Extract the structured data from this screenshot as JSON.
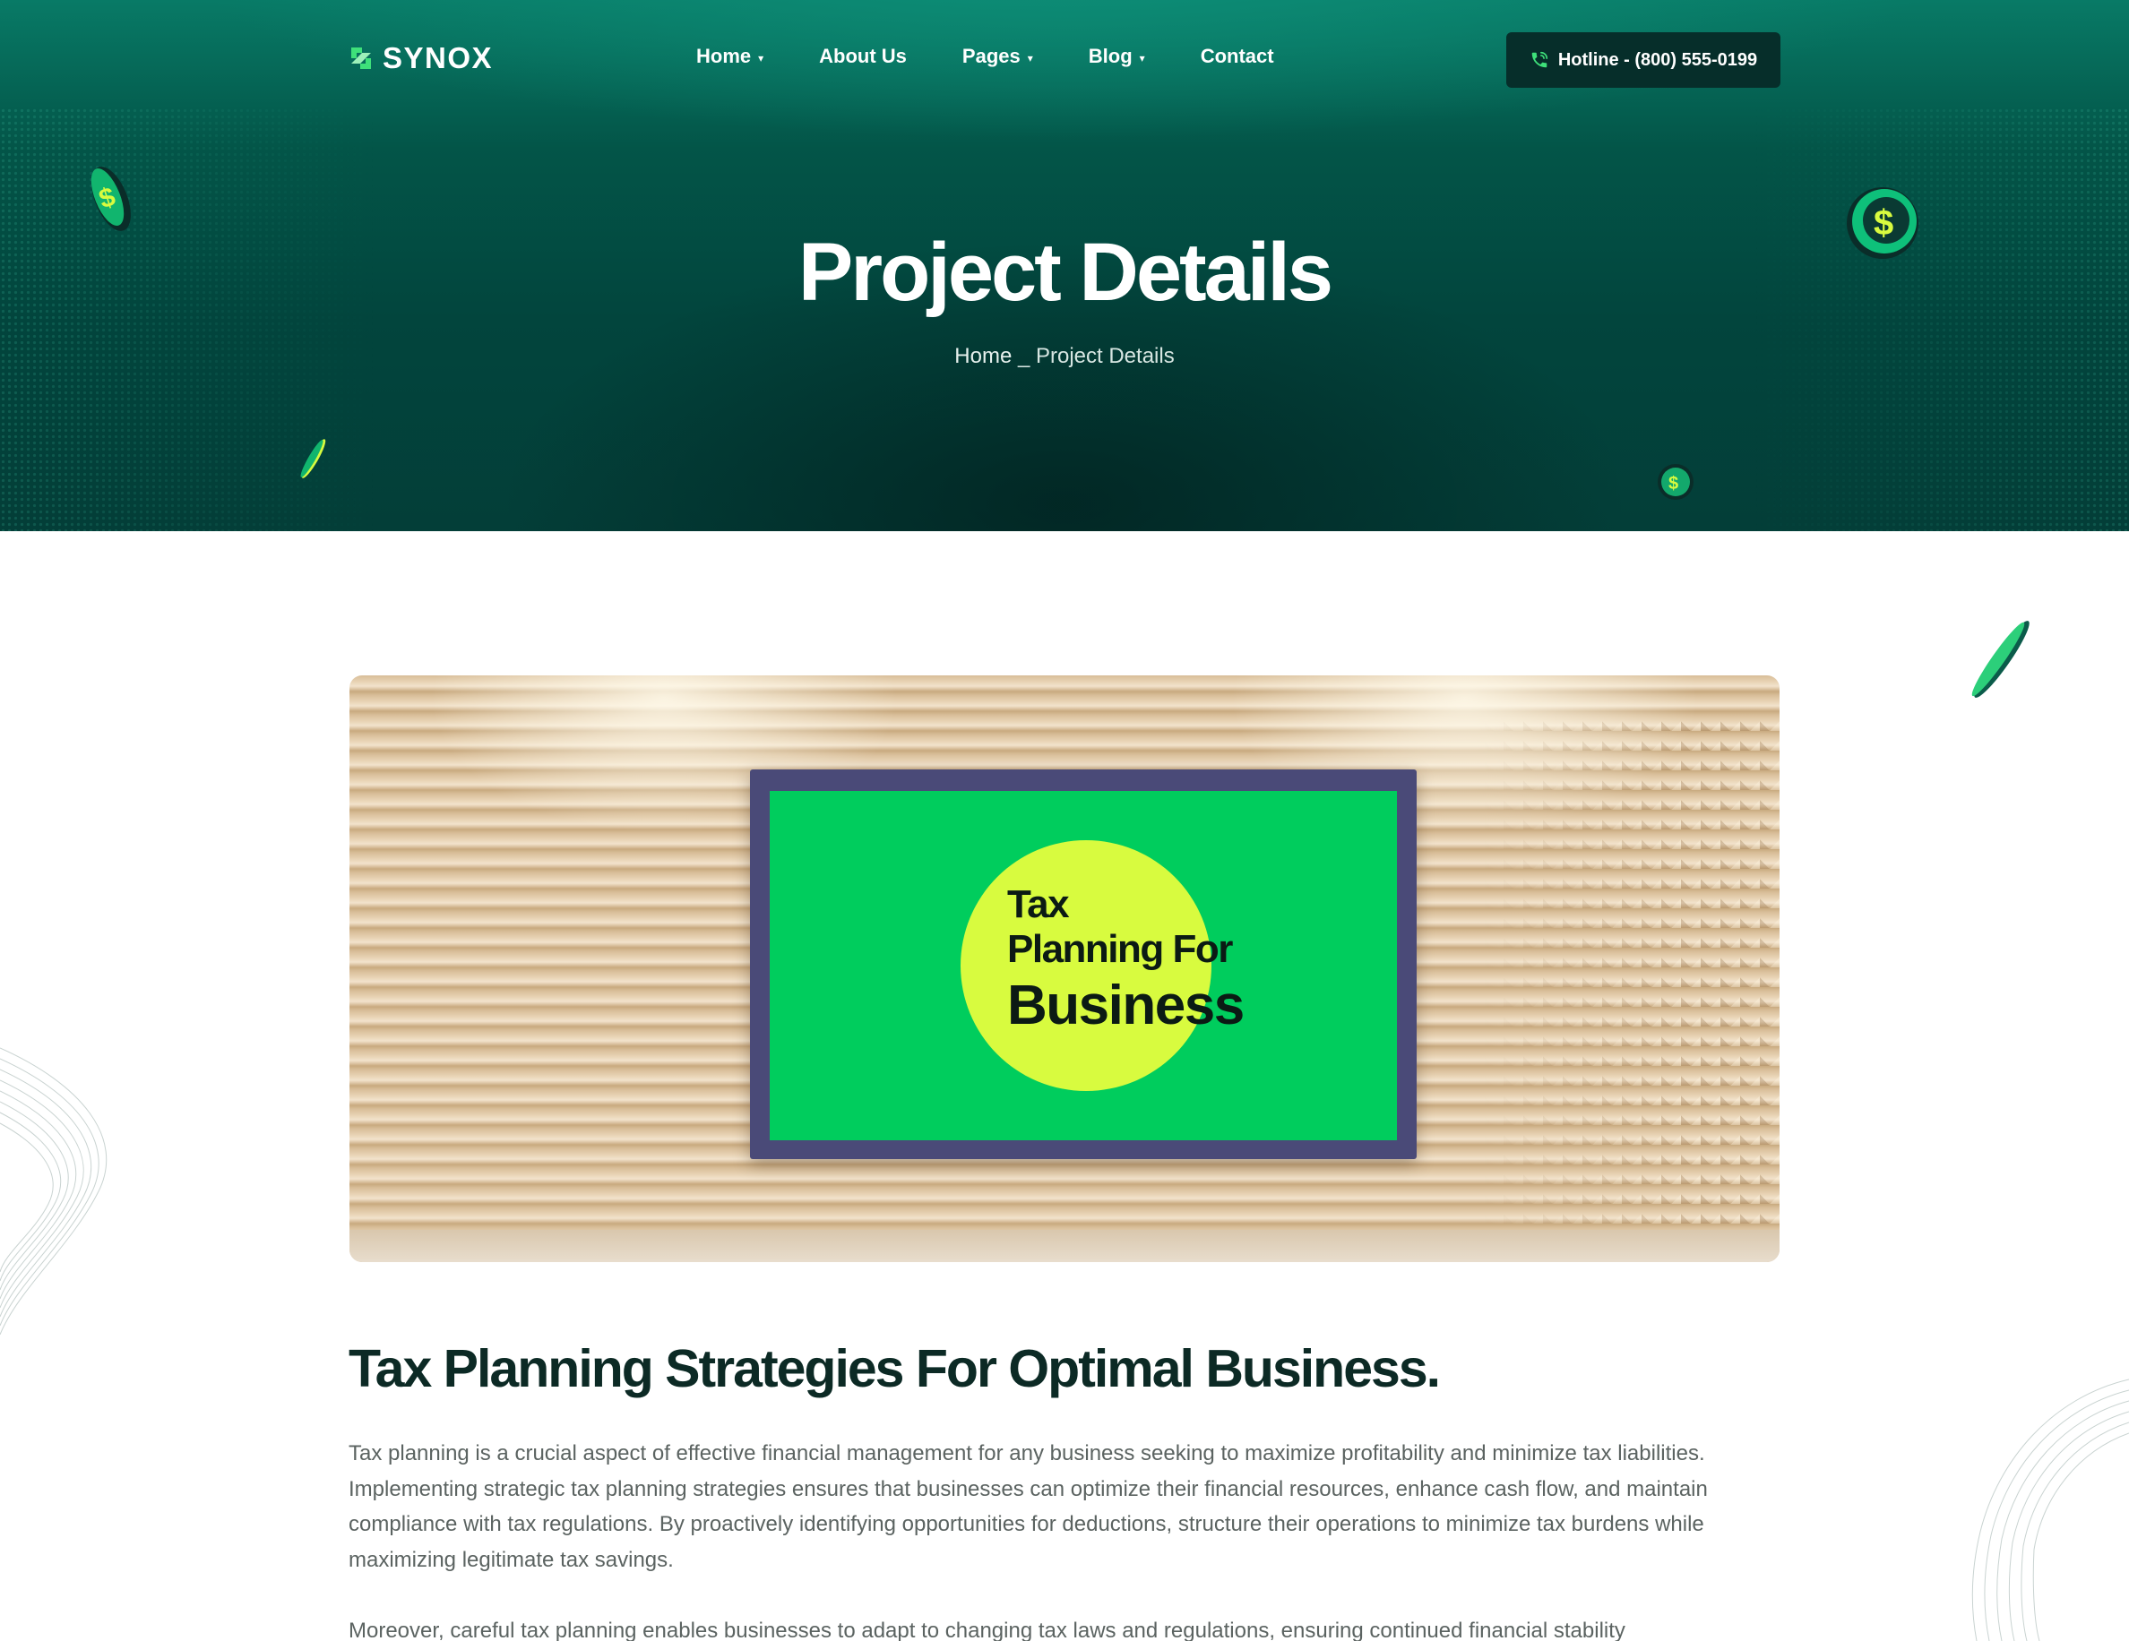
{
  "brand": {
    "name": "SYNOX",
    "accent": "#3ee07a"
  },
  "nav": {
    "items": [
      {
        "label": "Home",
        "caret": "▾"
      },
      {
        "label": "About Us",
        "caret": ""
      },
      {
        "label": "Pages",
        "caret": "▾"
      },
      {
        "label": "Blog",
        "caret": "▾"
      },
      {
        "label": "Contact",
        "caret": ""
      }
    ],
    "hotline": "Hotline - (800) 555-0199"
  },
  "hero": {
    "title": "Project Details",
    "breadcrumb": {
      "home": "Home",
      "separator": " _ ",
      "current": "Project Details"
    }
  },
  "image": {
    "screen_line1": "Tax",
    "screen_line2": "Planning For",
    "screen_line3": "Business"
  },
  "article": {
    "title": "Tax Planning Strategies For Optimal Business.",
    "paragraphs": [
      "Tax planning is a crucial aspect of effective financial management for any business seeking to maximize profitability and minimize tax liabilities. Implementing strategic tax planning strategies ensures that businesses can optimize their financial resources, enhance cash flow, and maintain compliance with tax regulations. By proactively identifying opportunities for deductions, structure their operations to minimize tax burdens while maximizing legitimate tax savings.",
      "Moreover, careful tax planning enables businesses to adapt to changing  tax laws and regulations, ensuring continued financial stability"
    ]
  },
  "colors": {
    "hero_dark": "#033e38",
    "hotline_bg": "#062e2a",
    "title_text": "#0c2a25",
    "body_text": "#5b6361",
    "screen_green": "#00cd5d",
    "screen_yellow": "#d8fb3f"
  }
}
